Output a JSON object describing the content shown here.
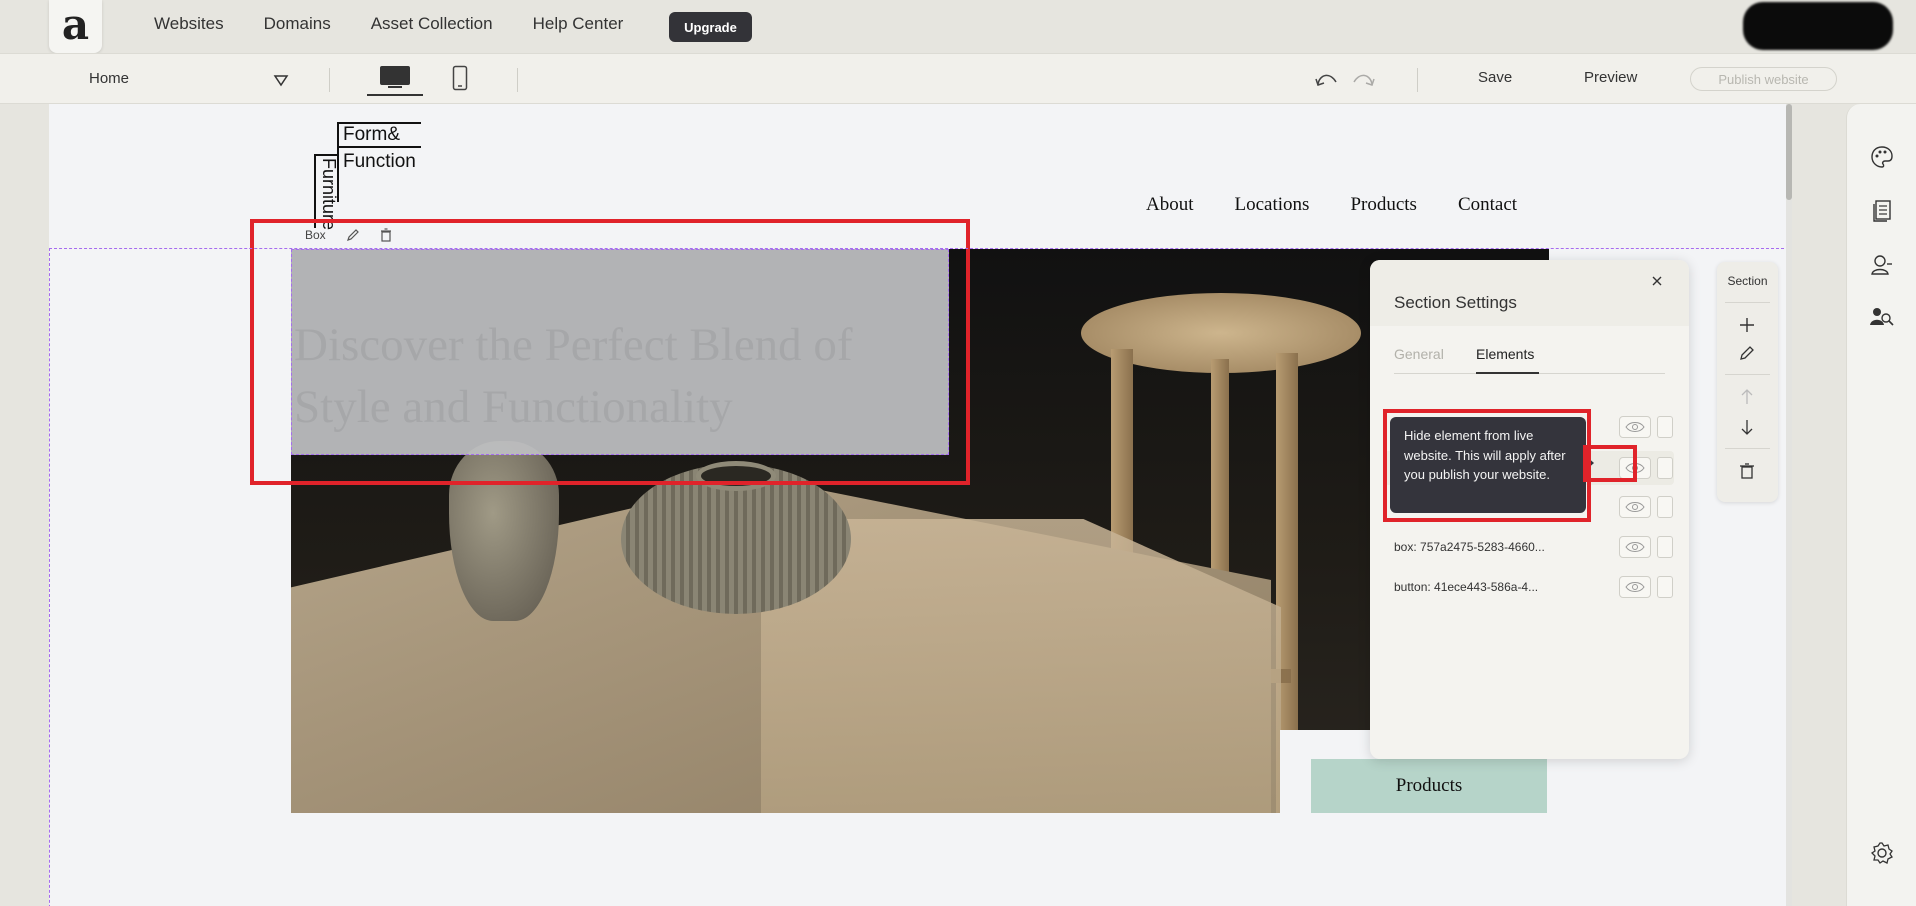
{
  "topnav": {
    "logo_letter": "a",
    "links": [
      "Websites",
      "Domains",
      "Asset Collection",
      "Help Center"
    ],
    "upgrade_label": "Upgrade"
  },
  "toolbar": {
    "page_name": "Home",
    "save_label": "Save",
    "preview_label": "Preview",
    "publish_label": "Publish website"
  },
  "site": {
    "brand_top": "Form&",
    "brand_middle": "Function",
    "brand_vertical": "Furniture",
    "nav": [
      "About",
      "Locations",
      "Products",
      "Contact"
    ],
    "hero_title": "Discover the Perfect Blend of Style and Functionality",
    "products_button": "Products"
  },
  "box_toolbar": {
    "label": "Box"
  },
  "panel": {
    "title": "Section Settings",
    "tab_general": "General",
    "tab_elements": "Elements",
    "rows": [
      "",
      "",
      "",
      "box: 757a2475-5283-4660...",
      "button: 41ece443-586a-4..."
    ],
    "tooltip": "Hide element from live website. This will apply after you publish your website."
  },
  "section_tools": {
    "label": "Section"
  },
  "colors": {
    "accent_red": "#e0232a",
    "selection_purple": "#a66bf0",
    "products_button_bg": "#b6d4c9",
    "upgrade_bg": "#333338"
  }
}
